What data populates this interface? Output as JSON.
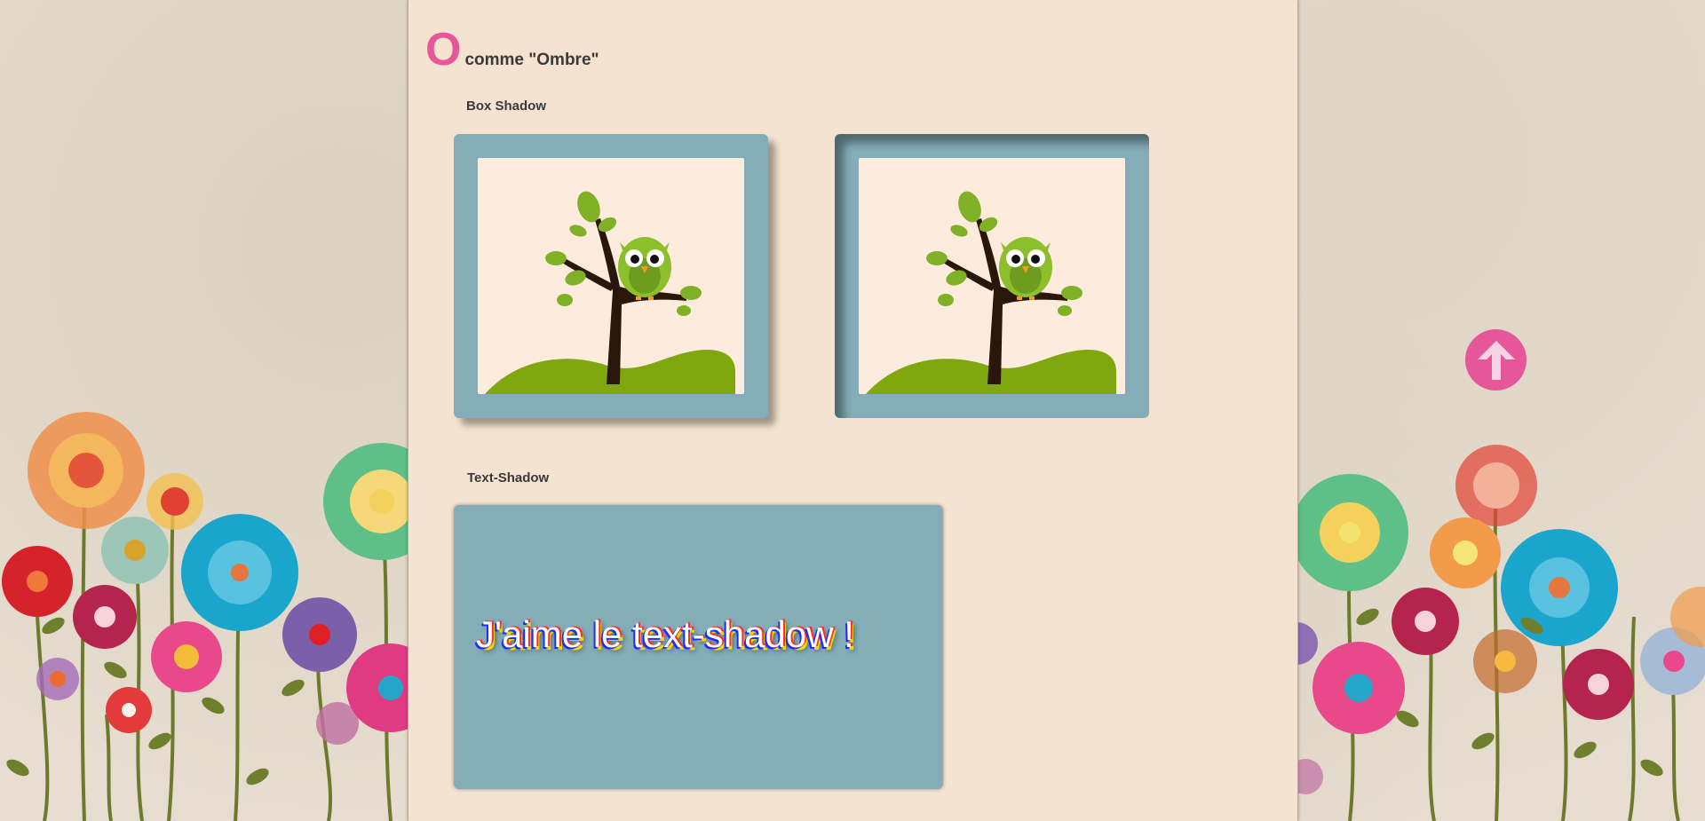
{
  "section": {
    "title_letter": "O",
    "title_rest": "comme \"Ombre\""
  },
  "box_shadow": {
    "heading": "Box Shadow",
    "images": [
      {
        "name": "owl-on-tree-outer-shadow"
      },
      {
        "name": "owl-on-tree-inner-shadow"
      }
    ]
  },
  "text_shadow": {
    "heading": "Text-Shadow",
    "sample_text": "J'aime le text-shadow !"
  },
  "scroll_top": {
    "icon": "arrow-up-icon"
  },
  "colors": {
    "accent": "#e6579a",
    "frame": "#84adb7",
    "panel_bg": "#f4e3d0",
    "picture_bg": "#fdebdd"
  }
}
